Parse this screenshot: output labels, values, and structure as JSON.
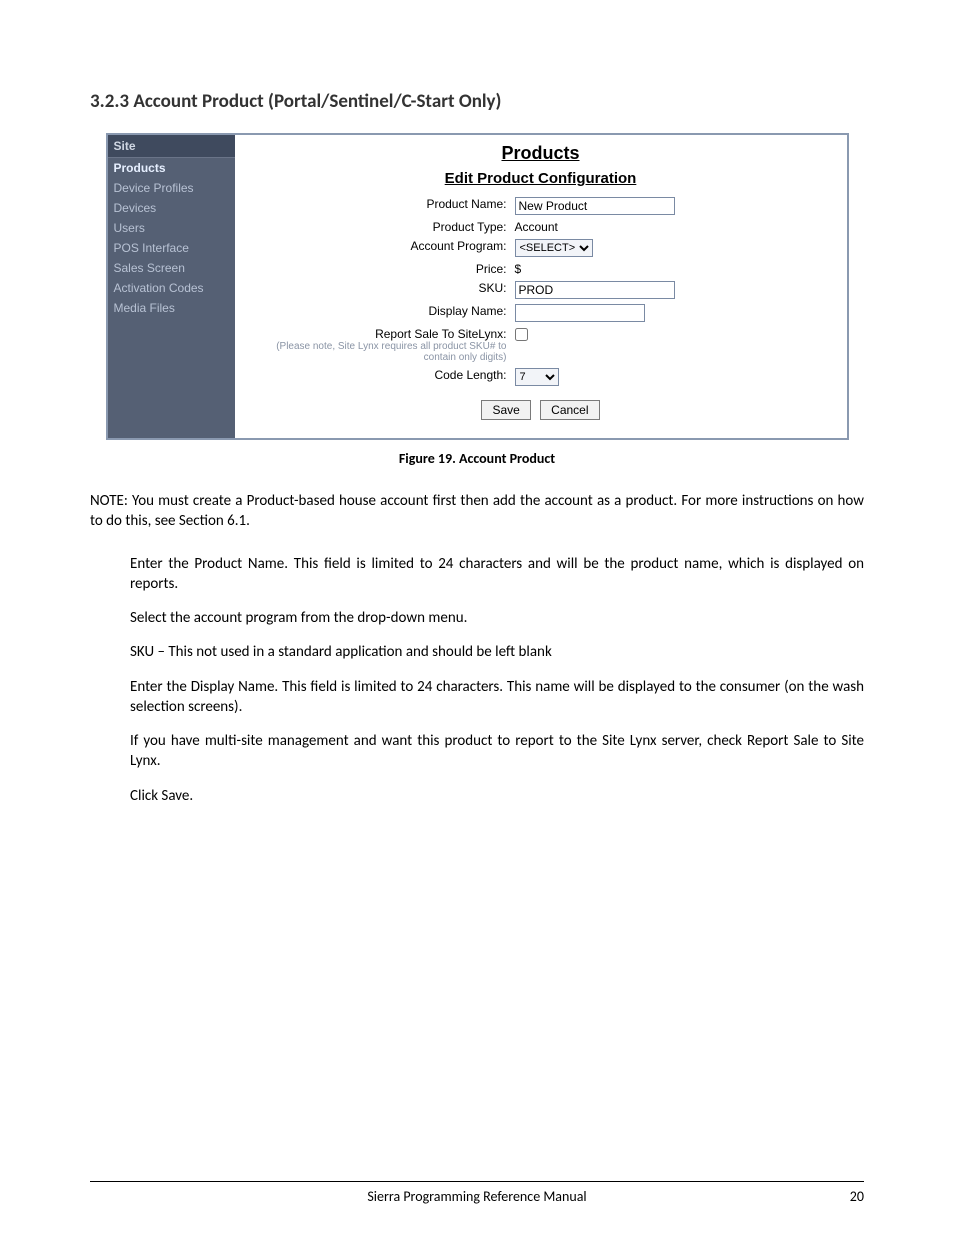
{
  "heading": "3.2.3  Account Product (Portal/Sentinel/C-Start Only)",
  "sidebar": {
    "header": "Site",
    "items": [
      {
        "label": "Products",
        "active": true
      },
      {
        "label": "Device Profiles",
        "active": false
      },
      {
        "label": "Devices",
        "active": false
      },
      {
        "label": "Users",
        "active": false
      },
      {
        "label": "POS Interface",
        "active": false
      },
      {
        "label": "Sales Screen",
        "active": false
      },
      {
        "label": "Activation Codes",
        "active": false
      },
      {
        "label": "Media Files",
        "active": false
      }
    ]
  },
  "panel": {
    "title": "Products",
    "subtitle": "Edit Product Configuration",
    "labels": {
      "product_name": "Product Name:",
      "product_type": "Product Type:",
      "account_program": "Account Program:",
      "price": "Price:",
      "sku": "SKU:",
      "display_name": "Display Name:",
      "report_sale": "Report Sale To SiteLynx:",
      "report_sale_note": "(Please note, Site Lynx requires all product SKU# to contain only digits)",
      "code_length": "Code Length:"
    },
    "values": {
      "product_name": "New Product",
      "product_type": "Account",
      "account_program": "<SELECT>",
      "price_prefix": "$",
      "sku": "PROD",
      "display_name": "",
      "code_length": "7"
    },
    "buttons": {
      "save": "Save",
      "cancel": "Cancel"
    }
  },
  "caption": "Figure 19. Account Product",
  "note": "NOTE: You must create a Product-based house account first then add the account as a product. For more instructions on how to do this, see Section 6.1.",
  "steps": [
    "Enter the Product Name. This field is limited to 24 characters and will be the product name, which is displayed on reports.",
    "Select the account program from the drop-down menu.",
    "SKU – This not used in a standard application and should be left blank",
    "Enter the Display Name. This field is limited to 24 characters. This name will be displayed to the consumer (on the wash selection screens).",
    "If you have multi-site management and want this product to report to the Site Lynx server, check Report Sale to Site Lynx.",
    "Click Save."
  ],
  "footer": {
    "title": "Sierra Programming Reference Manual",
    "page": "20"
  }
}
